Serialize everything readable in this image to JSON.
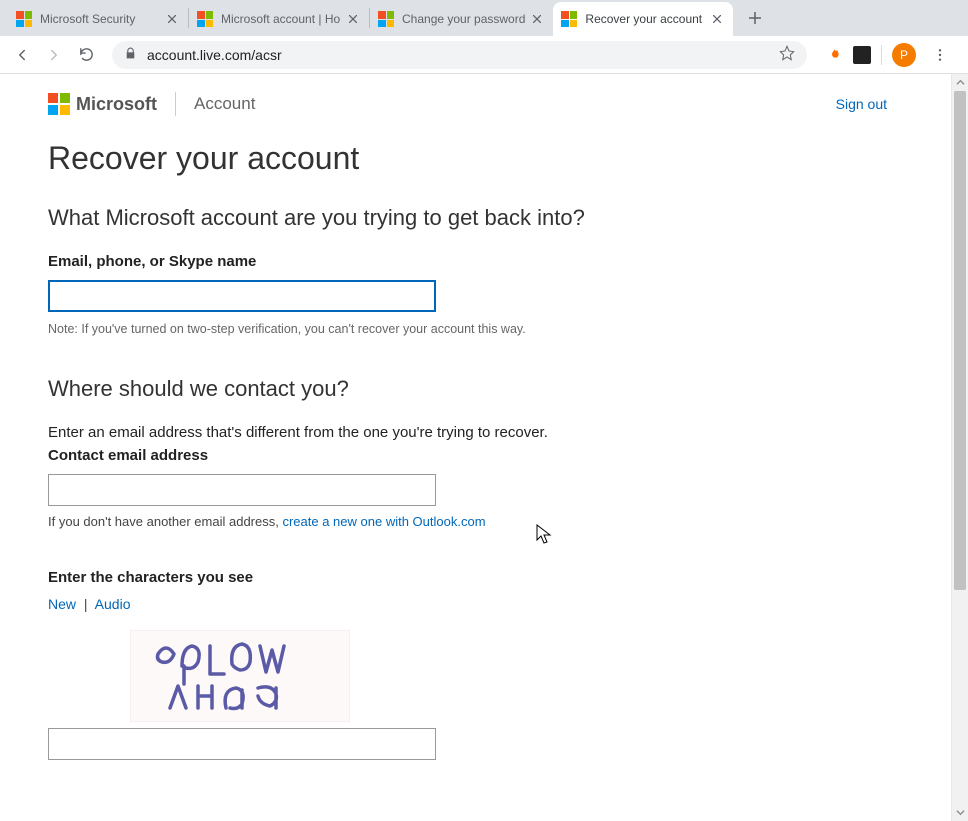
{
  "tabs": [
    {
      "title": "Microsoft Security"
    },
    {
      "title": "Microsoft account | Ho"
    },
    {
      "title": "Change your password"
    },
    {
      "title": "Recover your account"
    }
  ],
  "active_tab_index": 3,
  "address_bar": {
    "url": "account.live.com/acsr"
  },
  "avatar_letter": "P",
  "header": {
    "brand": "Microsoft",
    "section": "Account",
    "signout": "Sign out"
  },
  "page": {
    "title": "Recover your account",
    "q1": "What Microsoft account are you trying to get back into?",
    "field1_label": "Email, phone, or Skype name",
    "field1_value": "",
    "field1_hint": "Note: If you've turned on two-step verification, you can't recover your account this way.",
    "q2": "Where should we contact you?",
    "q2_sub": "Enter an email address that's different from the one you're trying to recover.",
    "field2_label": "Contact email address",
    "field2_value": "",
    "field2_hint_prefix": "If you don't have another email address, ",
    "field2_hint_link": "create a new one with Outlook.com",
    "captcha_label": "Enter the characters you see",
    "captcha_new": "New",
    "captcha_audio": "Audio",
    "captcha_text_approx": "GdLW XHaG"
  }
}
